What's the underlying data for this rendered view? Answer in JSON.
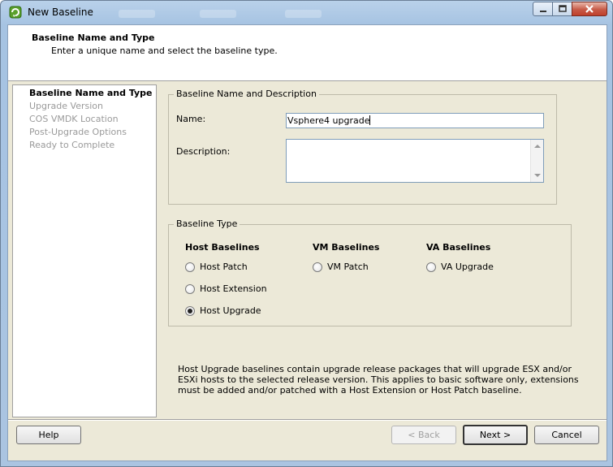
{
  "window": {
    "title": "New Baseline",
    "controls": {
      "minimize": "—",
      "maximize": "□",
      "close": "✕"
    }
  },
  "header": {
    "title": "Baseline Name and Type",
    "subtitle": "Enter a unique name and select the baseline type."
  },
  "steps": [
    {
      "label": "Baseline Name and Type",
      "active": true
    },
    {
      "label": "Upgrade Version",
      "active": false
    },
    {
      "label": "COS VMDK Location",
      "active": false
    },
    {
      "label": "Post-Upgrade Options",
      "active": false
    },
    {
      "label": "Ready to Complete",
      "active": false
    }
  ],
  "name_group": {
    "legend": "Baseline Name and Description",
    "name_label": "Name:",
    "name_value": "Vsphere4 upgrade",
    "description_label": "Description:",
    "description_value": ""
  },
  "type_group": {
    "legend": "Baseline Type",
    "columns": [
      {
        "heading": "Host Baselines",
        "options": [
          {
            "label": "Host Patch",
            "selected": false
          },
          {
            "label": "Host Extension",
            "selected": false
          },
          {
            "label": "Host Upgrade",
            "selected": true
          }
        ]
      },
      {
        "heading": "VM Baselines",
        "options": [
          {
            "label": "VM Patch",
            "selected": false
          }
        ]
      },
      {
        "heading": "VA Baselines",
        "options": [
          {
            "label": "VA Upgrade",
            "selected": false
          }
        ]
      }
    ]
  },
  "info_text": "Host Upgrade baselines contain upgrade release packages that will upgrade ESX and/or ESXi hosts to the selected release version. This applies to basic software only, extensions must be added and/or patched with a Host Extension or Host Patch baseline.",
  "buttons": {
    "help": "Help",
    "back": "< Back",
    "next": "Next >",
    "cancel": "Cancel"
  },
  "colors": {
    "title_bar": "#b9d1ea",
    "dialog_bg": "#ece9d8",
    "disabled_text": "#9a9a9a",
    "close_button": "#c75a47"
  },
  "icons": {
    "app": "baseline-app-icon"
  }
}
